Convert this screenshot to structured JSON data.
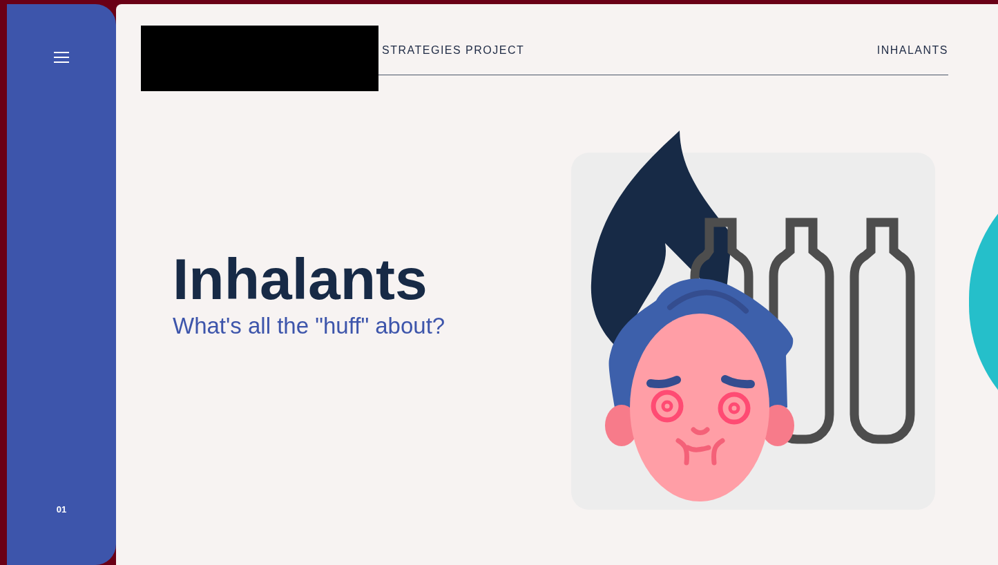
{
  "sidebar": {
    "page_number": "01"
  },
  "header": {
    "project": "STRATEGIES PROJECT",
    "section": "INHALANTS"
  },
  "slide": {
    "title": "Inhalants",
    "subtitle": "What's all the \"huff\" about?"
  }
}
